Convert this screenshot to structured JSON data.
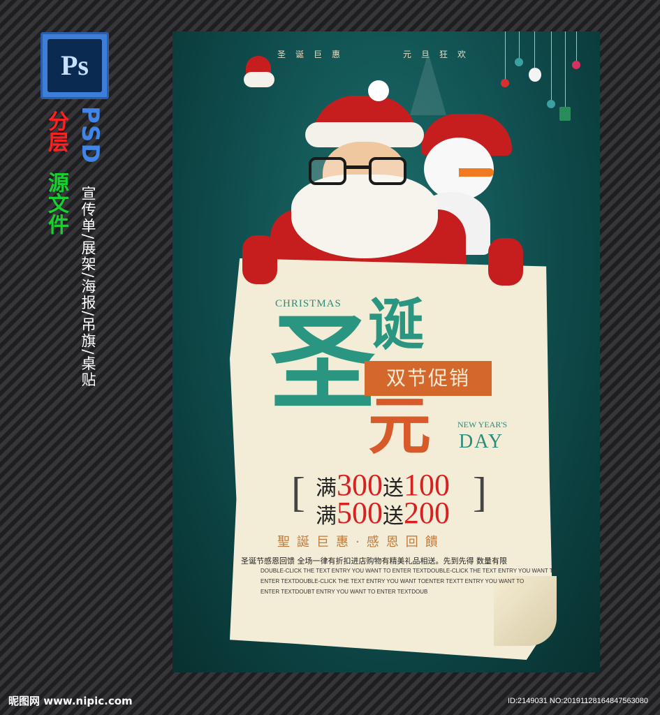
{
  "badge": {
    "ps_label": "Ps"
  },
  "side": {
    "psd": "PSD",
    "layered": "分层",
    "source": "源文件",
    "uses": "宣传单/展架/海报/吊旗/桌贴"
  },
  "poster": {
    "top_left": "圣诞巨惠",
    "top_right": "元旦狂欢",
    "christmas_en": "CHRISTMAS",
    "title_sheng": "圣",
    "title_dan": "诞",
    "title_yuan": "元",
    "promo": "双节促销",
    "newyear_en": "NEW YEAR'S",
    "day_en": "DAY",
    "offer1_prefix": "满",
    "offer1_amount": "300",
    "offer1_mid": "送",
    "offer1_gift": "100",
    "offer2_prefix": "满",
    "offer2_amount": "500",
    "offer2_mid": "送",
    "offer2_gift": "200",
    "bracket_left": "[",
    "bracket_right": "]",
    "slogan": "聖誕巨惠·感恩回饋",
    "description": "圣诞节感恩回馈 全场一律有折扣进店购物有精美礼品相送。先到先得 数量有限",
    "en_line1": "DOUBLE-CLICK THE TEXT ENTRY YOU WANT TO ENTER TEXTDOUBLE-CLICK THE TEXT ENTRY YOU WANT TO",
    "en_line2": "ENTER TEXTDOUBLE-CLICK THE TEXT ENTRY YOU WANT TOENTER TEXTT ENTRY YOU WANT TO",
    "en_line3": "ENTER TEXTDOUBT ENTRY YOU WANT TO ENTER TEXTDOUB"
  },
  "footer": {
    "logo": "昵图网 www.nipic.com",
    "id": "ID:2149031 NO:20191128164847563080"
  },
  "colors": {
    "poster_green": "#0f4b4c",
    "title_teal": "#2a9581",
    "accent_orange": "#d4682c",
    "price_red": "#d82020",
    "paper": "#f3ecd7"
  }
}
